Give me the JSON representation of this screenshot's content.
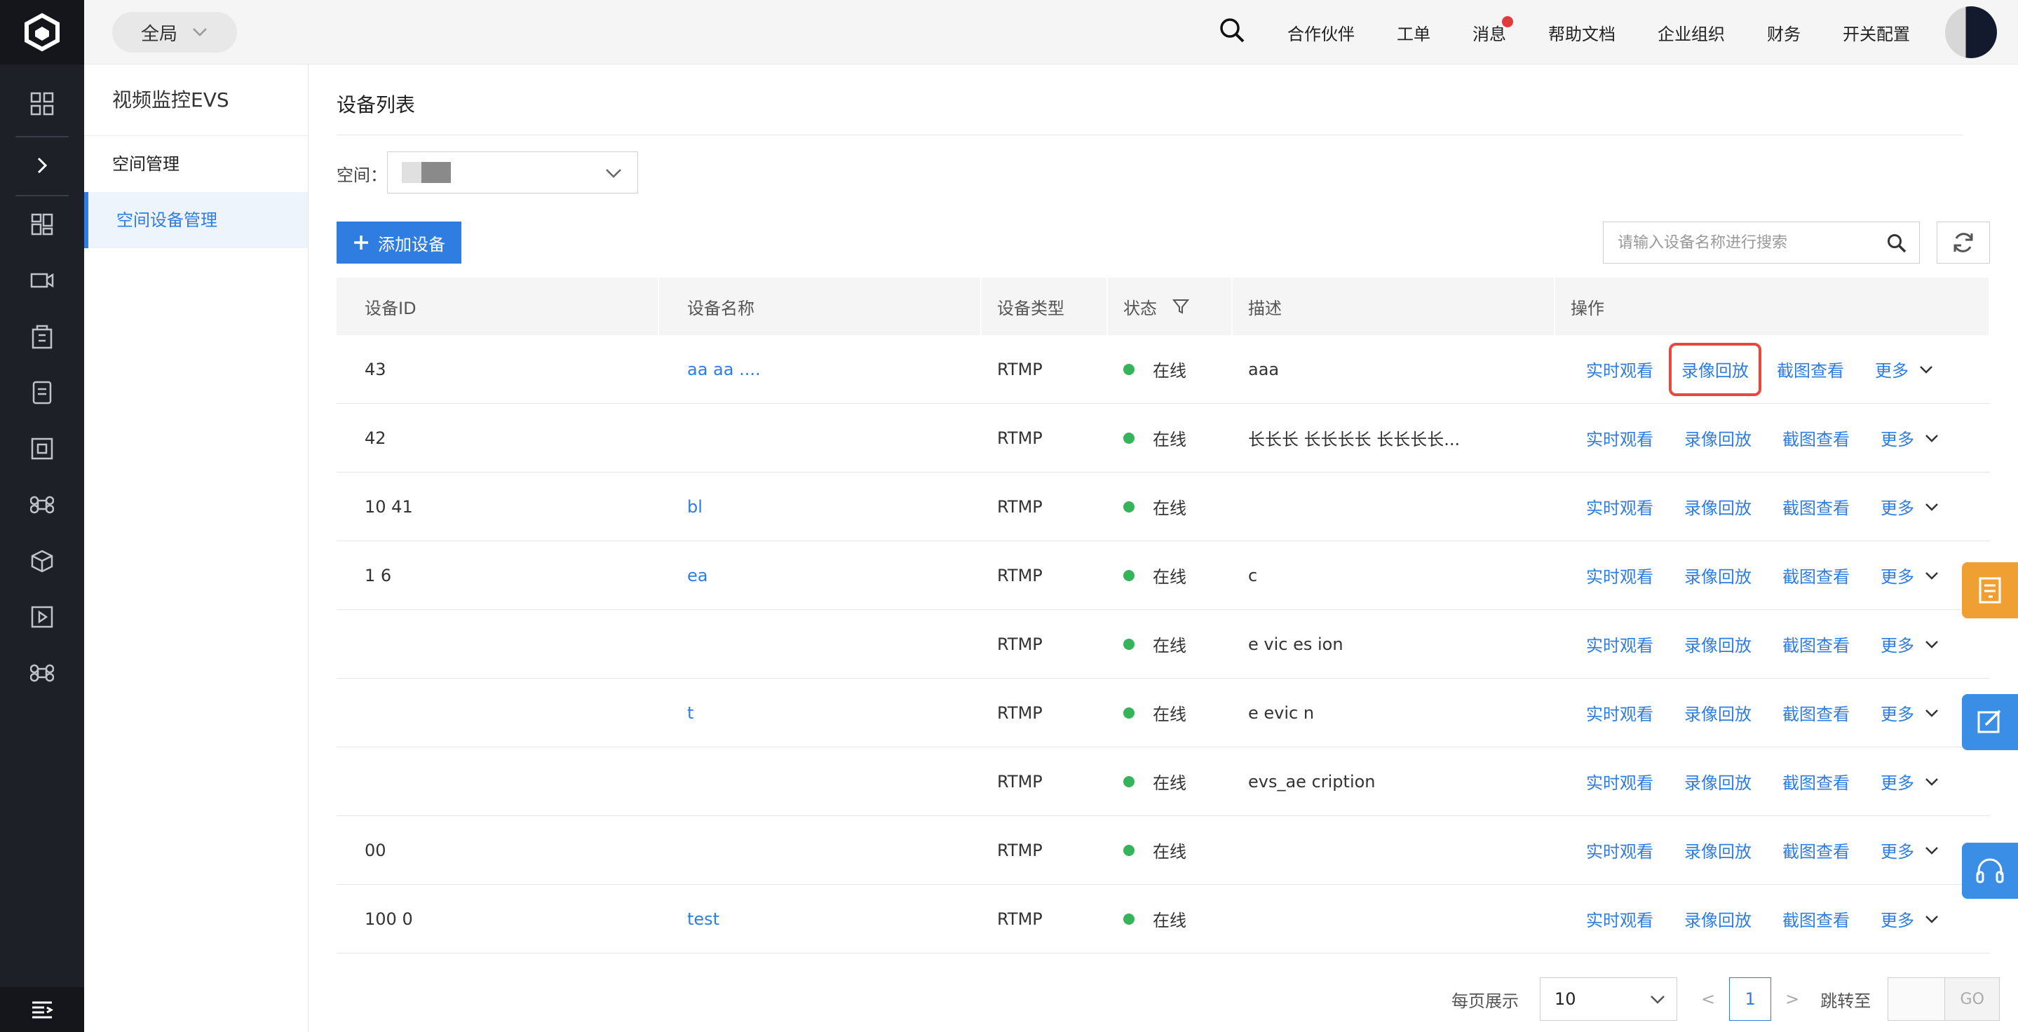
{
  "topbar": {
    "scope_label": "全局",
    "nav": [
      "合作伙伴",
      "工单",
      "消息",
      "帮助文档",
      "企业组织",
      "财务",
      "开关配置"
    ]
  },
  "subnav": {
    "title": "视频监控EVS",
    "group": "空间管理",
    "active_item": "空间设备管理"
  },
  "main": {
    "page_title": "设备列表",
    "space_label": "空间：",
    "add_button": "添加设备",
    "search_placeholder": "请输入设备名称进行搜索"
  },
  "table": {
    "headers": [
      "设备ID",
      "设备名称",
      "设备类型",
      "状态",
      "描述",
      "操作"
    ],
    "rows": [
      {
        "id": "43",
        "name": "aa aa ....",
        "type": "RTMP",
        "status": "在线",
        "desc": "aaa",
        "highlight": true
      },
      {
        "id": "42",
        "name": "",
        "type": "RTMP",
        "status": "在线",
        "desc": "长长长 长长长长 长长长长...",
        "highlight": false
      },
      {
        "id": "10 41",
        "name": "bl",
        "type": "RTMP",
        "status": "在线",
        "desc": "",
        "highlight": false
      },
      {
        "id": "1 6",
        "name": "ea",
        "type": "RTMP",
        "status": "在线",
        "desc": "c",
        "highlight": false
      },
      {
        "id": "",
        "name": "",
        "type": "RTMP",
        "status": "在线",
        "desc": "e vic es ion",
        "highlight": false
      },
      {
        "id": "",
        "name": "t",
        "type": "RTMP",
        "status": "在线",
        "desc": "e evic n",
        "highlight": false
      },
      {
        "id": "",
        "name": "",
        "type": "RTMP",
        "status": "在线",
        "desc": "evs_ae cription",
        "highlight": false
      },
      {
        "id": "00",
        "name": "",
        "type": "RTMP",
        "status": "在线",
        "desc": "",
        "highlight": false
      },
      {
        "id": "100 0",
        "name": "test",
        "type": "RTMP",
        "status": "在线",
        "desc": "",
        "highlight": false
      }
    ],
    "ops": [
      "实时观看",
      "录像回放",
      "截图查看",
      "更多"
    ]
  },
  "pager": {
    "page_size_label": "每页展示",
    "page_size": "10",
    "prev": "<",
    "current_page": "1",
    "next": ">",
    "jump_label": "跳转至",
    "go_label": "GO"
  },
  "colors": {
    "accent": "#2f7de1",
    "rail": "#1e2028",
    "online": "#36b45a",
    "highlight": "#e64a3b",
    "float_orange": "#f0a033",
    "float_blue": "#3a8ee6"
  }
}
